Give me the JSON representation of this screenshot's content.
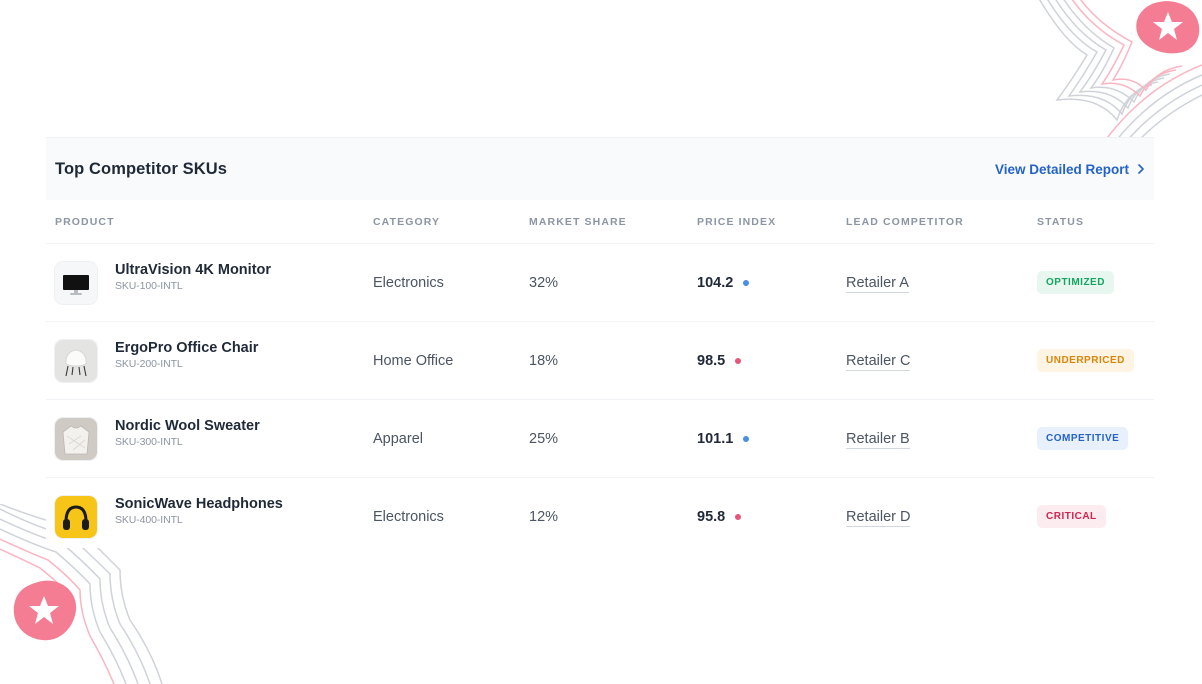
{
  "card": {
    "title": "Top Competitor SKUs",
    "report_link": "View Detailed Report"
  },
  "table": {
    "columns": [
      "PRODUCT",
      "CATEGORY",
      "MARKET SHARE",
      "PRICE INDEX",
      "LEAD COMPETITOR",
      "STATUS"
    ],
    "rows": [
      {
        "name": "UltraVision 4K Monitor",
        "sku": "SKU-100-INTL",
        "category": "Electronics",
        "market_share": "32%",
        "price_index": "104.2",
        "lead_competitor": "Retailer A",
        "status": "OPTIMIZED",
        "thumbnail_icon": "monitor-icon"
      },
      {
        "name": "ErgoPro Office Chair",
        "sku": "SKU-200-INTL",
        "category": "Home Office",
        "market_share": "18%",
        "price_index": "98.5",
        "lead_competitor": "Retailer C",
        "status": "UNDERPRICED",
        "thumbnail_icon": "chair-icon"
      },
      {
        "name": "Nordic Wool Sweater",
        "sku": "SKU-300-INTL",
        "category": "Apparel",
        "market_share": "25%",
        "price_index": "101.1",
        "lead_competitor": "Retailer B",
        "status": "COMPETITIVE",
        "thumbnail_icon": "sweater-icon"
      },
      {
        "name": "SonicWave Headphones",
        "sku": "SKU-400-INTL",
        "category": "Electronics",
        "market_share": "12%",
        "price_index": "95.8",
        "lead_competitor": "Retailer D",
        "status": "CRITICAL",
        "thumbnail_icon": "headphones-icon"
      }
    ]
  },
  "colors": {
    "link": "#2563c9",
    "dot_above": "#4a90e2",
    "dot_below": "#e8557a",
    "optimized": {
      "bg": "#e7f7ef",
      "fg": "#16a363"
    },
    "underpriced": {
      "bg": "#fdf4e3",
      "fg": "#d9860b"
    },
    "competitive": {
      "bg": "#e8f0fc",
      "fg": "#2563c9"
    },
    "critical": {
      "bg": "#fdecef",
      "fg": "#d1244f"
    },
    "decoration_star": "#f57d93"
  }
}
